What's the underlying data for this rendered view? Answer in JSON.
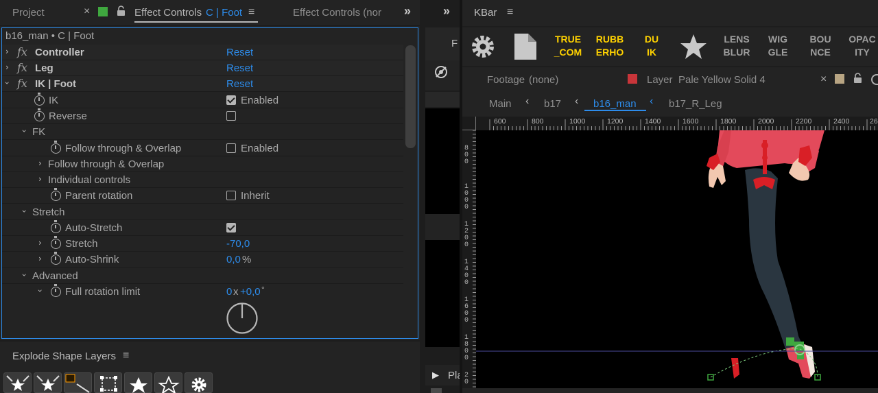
{
  "left_tabs": {
    "project": "Project",
    "effect_controls_active": "Effect Controls",
    "effect_controls_active_layer": "C | Foot",
    "effect_controls_other": "Effect Controls (nor"
  },
  "breadcrumb": "b16_man • C | Foot",
  "effects": {
    "controller": {
      "name": "Controller",
      "reset": "Reset"
    },
    "leg": {
      "name": "Leg",
      "reset": "Reset"
    },
    "ik_foot": {
      "name": "IK | Foot",
      "reset": "Reset"
    }
  },
  "params": {
    "ik": {
      "label": "IK",
      "checkbox_label": "Enabled"
    },
    "reverse": {
      "label": "Reverse"
    },
    "fk": {
      "label": "FK"
    },
    "follow1": {
      "label": "Follow through & Overlap",
      "checkbox_label": "Enabled"
    },
    "follow2": {
      "label": "Follow through & Overlap"
    },
    "individual": {
      "label": "Individual controls"
    },
    "parent_rotation": {
      "label": "Parent rotation",
      "checkbox_label": "Inherit"
    },
    "stretch_group": {
      "label": "Stretch"
    },
    "auto_stretch": {
      "label": "Auto-Stretch"
    },
    "stretch": {
      "label": "Stretch",
      "value": "-70,0"
    },
    "auto_shrink": {
      "label": "Auto-Shrink",
      "value": "0,0",
      "unit": "%"
    },
    "advanced": {
      "label": "Advanced"
    },
    "full_rotation": {
      "label": "Full rotation limit",
      "revolutions": "0",
      "x": "x",
      "degrees": "+0,0",
      "unit": "°"
    }
  },
  "explode_panel": {
    "title": "Explode Shape Layers"
  },
  "middle": {
    "label_f": "F",
    "label_pla": "Pla"
  },
  "kbar": {
    "title": "KBar",
    "buttons": [
      {
        "label": "TRUE\n_COM",
        "color": "#ffd200"
      },
      {
        "label": "RUBB\nERHO",
        "color": "#ffd200"
      },
      {
        "label": "DU\nIK",
        "color": "#ffd200"
      },
      {
        "label": "LENS\nBLUR",
        "color": "#9e9e9e"
      },
      {
        "label": "WIG\nGLE",
        "color": "#9e9e9e"
      },
      {
        "label": "BOU\nNCE",
        "color": "#9e9e9e"
      },
      {
        "label": "OPAC\nITY",
        "color": "#9e9e9e"
      }
    ]
  },
  "viewer": {
    "footage_tab": "Footage",
    "footage_value": "(none)",
    "layer_tab": "Layer",
    "layer_value": "Pale Yellow Solid 4",
    "crumbs": [
      "Main",
      "b17",
      "b16_man",
      "b17_R_Leg"
    ]
  },
  "ruler": {
    "top_ticks": [
      "600",
      "800",
      "1000",
      "1200",
      "1400",
      "1600",
      "1800",
      "2000",
      "2200",
      "2400",
      "26"
    ],
    "left_ticks": [
      "8\n0\n0",
      "1\n0\n0\n0",
      "1\n2\n0\n0",
      "1\n4\n0\n0",
      "1\n6\n0\n0",
      "1\n8\n0\n0",
      "2\n0"
    ]
  },
  "colors": {
    "accent_blue": "#2d8ceb",
    "kbar_yellow": "#ffd200",
    "green_label": "#3fa83f",
    "red_label": "#c8353a",
    "tan_label": "#b8a583"
  }
}
